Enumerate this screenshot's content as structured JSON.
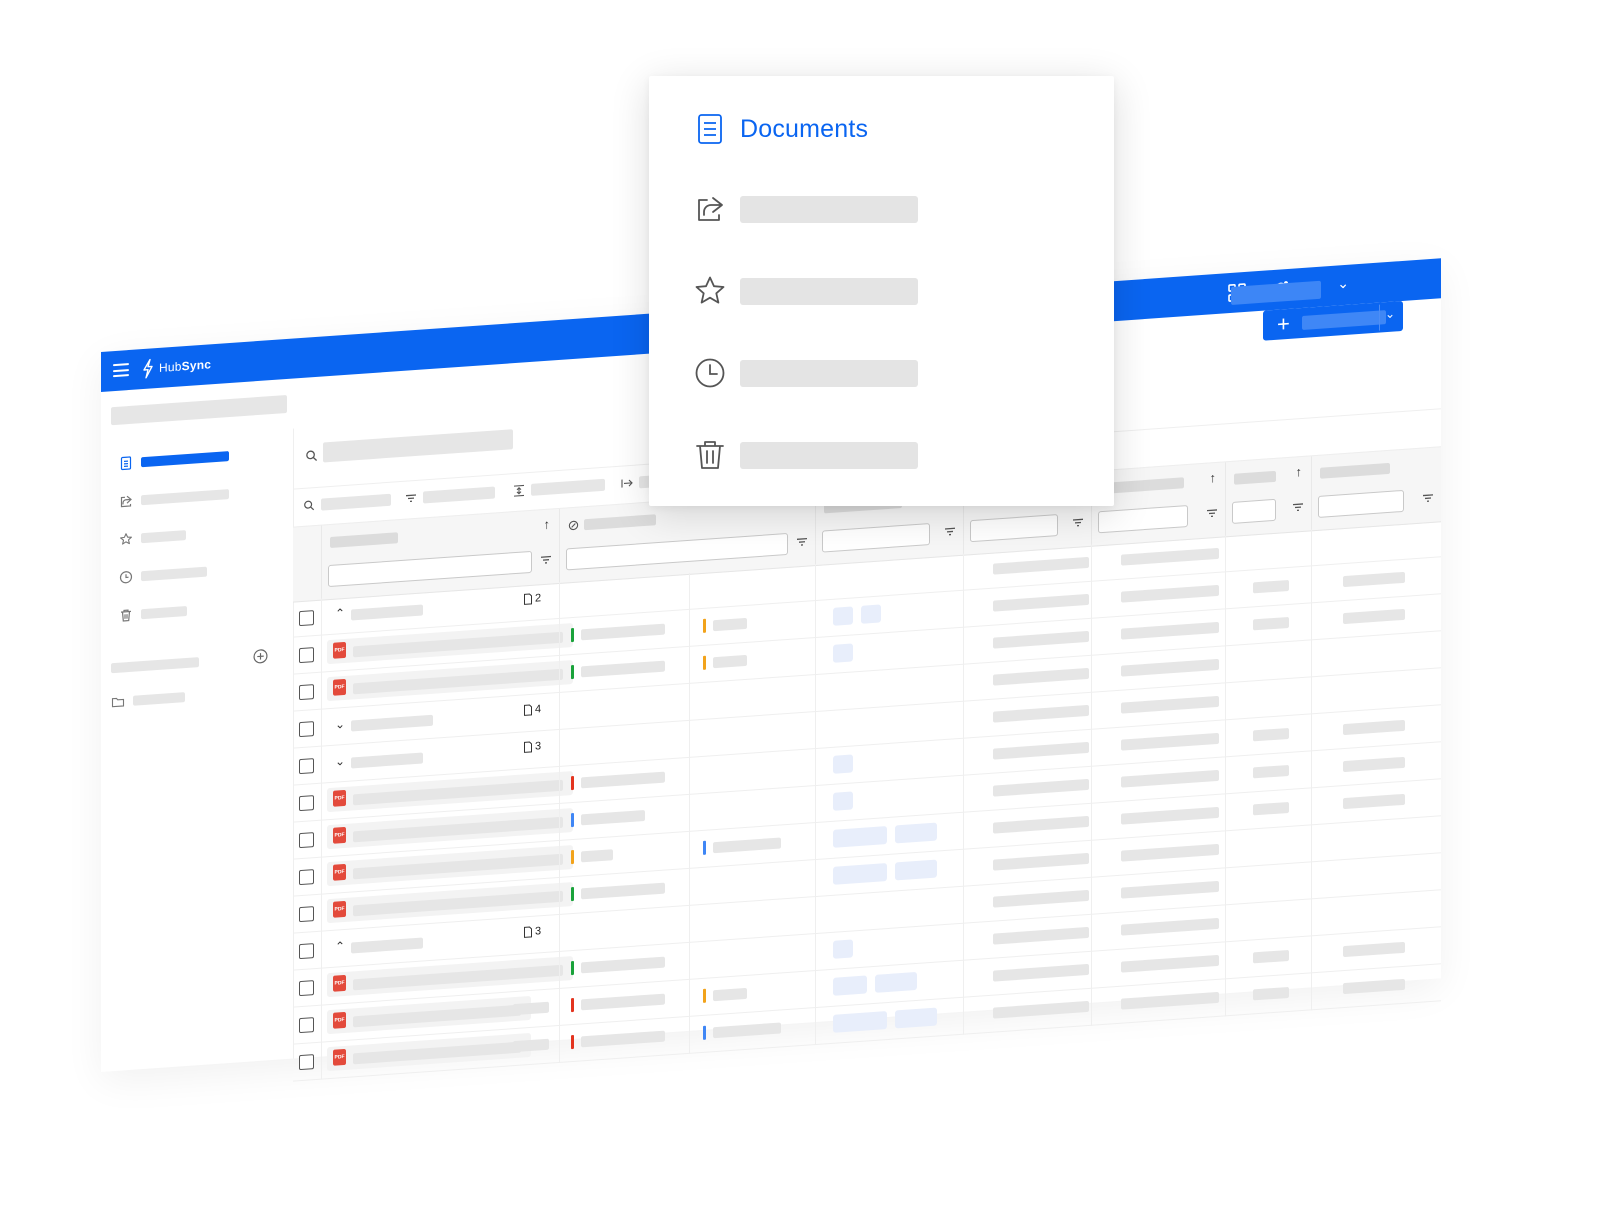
{
  "app": {
    "brand": {
      "prefix": "Hub",
      "suffix": "Sync"
    },
    "colors": {
      "primary": "#0a65f1",
      "placeholder": "#e6e6e6",
      "pdf": "#e34a3b",
      "tag_green": "#19a23a",
      "tag_orange": "#f2a31b",
      "tag_red": "#e3341f",
      "tag_blue": "#3f86f5"
    },
    "topbar_icons": [
      "menu-icon",
      "apps-grid-icon",
      "notification-bell-icon",
      "chevron-down-icon"
    ],
    "new_button": {
      "icon": "plus-icon",
      "dropdown_icon": "chevron-down-icon"
    },
    "sidebar_icons": [
      "document-icon",
      "share-icon",
      "star-icon",
      "clock-icon",
      "trash-icon",
      "add-circle-icon",
      "folder-icon"
    ],
    "group_counts": [
      "2",
      "4",
      "3",
      "3"
    ],
    "file_badge": "PDF"
  },
  "nav_menu": {
    "items": [
      {
        "icon": "document-icon",
        "label": "Documents",
        "active": true
      },
      {
        "icon": "share-icon",
        "label": ""
      },
      {
        "icon": "star-icon",
        "label": ""
      },
      {
        "icon": "clock-icon",
        "label": ""
      },
      {
        "icon": "trash-icon",
        "label": ""
      }
    ]
  }
}
